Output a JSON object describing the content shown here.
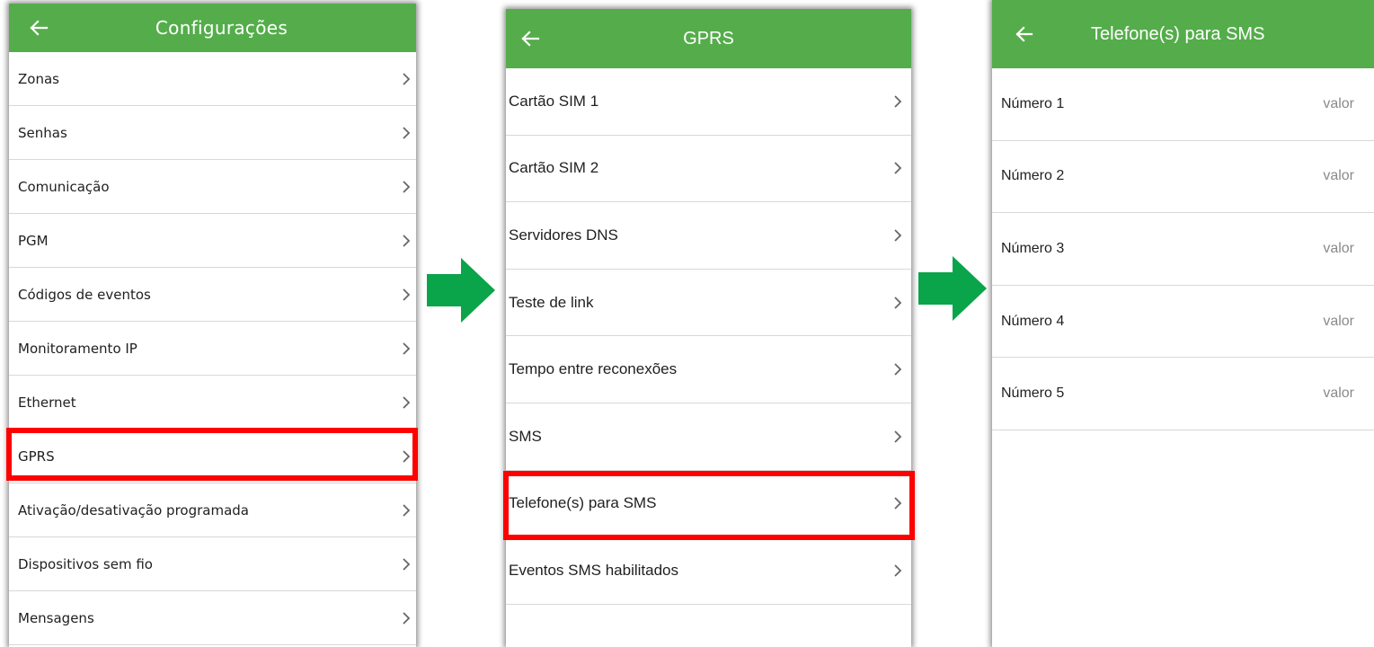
{
  "colors": {
    "appbar": "#54ad4a",
    "highlight": "#ff0000",
    "flow_arrow": "#0aa44a"
  },
  "icons": {
    "back": "arrow-left-icon",
    "chevron": "chevron-right-icon",
    "flow": "flow-arrow-right-icon"
  },
  "screen1": {
    "title": "Configurações",
    "items": [
      {
        "label": "Zonas"
      },
      {
        "label": "Senhas"
      },
      {
        "label": "Comunicação"
      },
      {
        "label": "PGM"
      },
      {
        "label": "Códigos de eventos"
      },
      {
        "label": "Monitoramento IP"
      },
      {
        "label": "Ethernet"
      },
      {
        "label": "GPRS"
      },
      {
        "label": "Ativação/desativação programada"
      },
      {
        "label": "Dispositivos sem fio"
      },
      {
        "label": "Mensagens"
      }
    ],
    "highlighted": "GPRS"
  },
  "screen2": {
    "title": "GPRS",
    "items": [
      {
        "label": "Cartão SIM 1"
      },
      {
        "label": "Cartão SIM 2"
      },
      {
        "label": "Servidores DNS"
      },
      {
        "label": "Teste de link"
      },
      {
        "label": "Tempo entre reconexões"
      },
      {
        "label": "SMS"
      },
      {
        "label": "Telefone(s) para SMS"
      },
      {
        "label": "Eventos SMS habilitados"
      }
    ],
    "highlighted": "Telefone(s) para SMS"
  },
  "screen3": {
    "title": "Telefone(s) para SMS",
    "items": [
      {
        "label": "Número 1",
        "value": "valor"
      },
      {
        "label": "Número 2",
        "value": "valor"
      },
      {
        "label": "Número 3",
        "value": "valor"
      },
      {
        "label": "Número 4",
        "value": "valor"
      },
      {
        "label": "Número 5",
        "value": "valor"
      }
    ]
  }
}
